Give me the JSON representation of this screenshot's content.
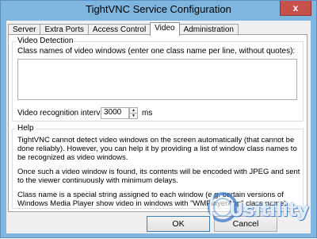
{
  "window": {
    "title": "TightVNC Service Configuration",
    "close_glyph": "x",
    "accent_color": "#7fb6e0",
    "close_color": "#c7504a"
  },
  "tabs": [
    {
      "label": "Server",
      "active": false
    },
    {
      "label": "Extra Ports",
      "active": false
    },
    {
      "label": "Access Control",
      "active": false
    },
    {
      "label": "Video",
      "active": true
    },
    {
      "label": "Administration",
      "active": false
    }
  ],
  "video_detection": {
    "title": "Video Detection",
    "class_names_label": "Class names of video windows (enter one class name per line, without quotes):",
    "class_names_value": "",
    "interval_label": "Video recognition interval:",
    "interval_value": "3000",
    "interval_unit": "ms"
  },
  "help": {
    "title": "Help",
    "paragraphs": [
      "TightVNC cannot detect video windows on the screen automatically (that cannot be done reliably). However, you can help it by providing a list of window class names to be recognized as video windows.",
      "Once such a video window is found, its contents will be encoded with JPEG and sent to the viewer continuously with minimum delays.",
      "Class name is a special string assigned to each window (e.g. certain versions of Windows Media Player show video in windows with \"WMPlayerApp\" class name)."
    ]
  },
  "buttons": {
    "ok": "OK",
    "cancel": "Cancel"
  },
  "watermark": {
    "text": "Usitility",
    "icon": "usitility-logo-icon"
  }
}
